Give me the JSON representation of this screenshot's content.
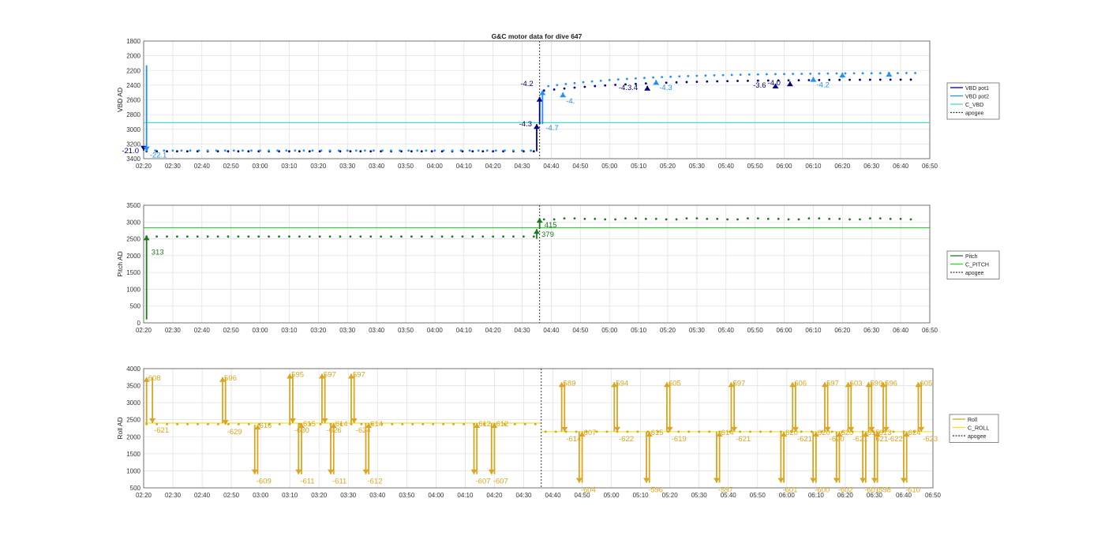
{
  "figure": {
    "title": "G&C motor data for dive 647"
  },
  "colors": {
    "vbd_pot1": "#00008B",
    "vbd_pot2": "#1E90FF",
    "c_vbd": "#40E0D0",
    "pitch": "#1E7A1E",
    "c_pitch": "#32CD32",
    "roll": "#DAA520",
    "c_roll": "#F0E130",
    "apogee": "#333333",
    "grid": "#e2e2e2"
  },
  "chart_data": [
    {
      "type": "scatter",
      "name": "vbd",
      "ylabel": "VBD AD",
      "xlabel": "",
      "xlim": [
        "02:20",
        "06:50"
      ],
      "xticks": [
        "02:20",
        "02:30",
        "02:40",
        "02:50",
        "03:00",
        "03:10",
        "03:20",
        "03:30",
        "03:40",
        "03:50",
        "04:00",
        "04:10",
        "04:20",
        "04:30",
        "04:40",
        "04:50",
        "05:00",
        "05:10",
        "05:20",
        "05:30",
        "05:40",
        "05:50",
        "06:00",
        "06:10",
        "06:20",
        "06:30",
        "06:40",
        "06:50"
      ],
      "ylim": [
        1800,
        3400
      ],
      "yreversed": true,
      "yticks": [
        1800,
        2000,
        2200,
        2400,
        2600,
        2800,
        3000,
        3200,
        3400
      ],
      "grid": true,
      "legend": [
        "VBD pot1",
        "VBD pot2",
        "C_VBD",
        "apogee"
      ],
      "apogee": "04:36",
      "c_line": 2910,
      "series": [
        {
          "name": "VBD pot1",
          "color_key": "vbd_pot1",
          "x_start": "02:21",
          "x_end": "06:45",
          "y_desc": 3300,
          "y_asc": 2320,
          "split": "04:36"
        },
        {
          "name": "VBD pot2",
          "color_key": "vbd_pot2",
          "x_start": "02:21",
          "x_end": "06:45",
          "y_desc": 3290,
          "y_asc": 2230,
          "split": "04:36"
        }
      ],
      "moves": [
        {
          "x": "02:20",
          "y_from": 3280,
          "y_to": 3290,
          "label": "-21.0",
          "series": "VBD pot1"
        },
        {
          "x": "02:21",
          "y_from": 2130,
          "y_to": 3300,
          "label": "-22.1",
          "series": "VBD pot2"
        },
        {
          "x": "04:35",
          "y_from": 3300,
          "y_to": 2930,
          "label": "-4.3",
          "series": "VBD pot1"
        },
        {
          "x": "04:36",
          "y_from": 2930,
          "y_to": 2560,
          "label": "-4.2",
          "series": "VBD pot1"
        },
        {
          "x": "04:37",
          "y_from": 2930,
          "y_to": 2470,
          "label": "-4.7",
          "series": "VBD pot2"
        },
        {
          "x": "04:44",
          "y_from": 2560,
          "y_to": 2500,
          "label": "-4.",
          "series": "VBD pot2"
        },
        {
          "x": "05:13",
          "y_from": 2470,
          "y_to": 2410,
          "label": "-4.3.4",
          "series": "VBD pot1"
        },
        {
          "x": "05:16",
          "y_from": 2380,
          "y_to": 2330,
          "label": "-4.3",
          "series": "VBD pot2"
        },
        {
          "x": "05:57",
          "y_from": 2400,
          "y_to": 2380,
          "label": "-3.6",
          "series": "VBD pot1"
        },
        {
          "x": "06:02",
          "y_from": 2380,
          "y_to": 2350,
          "label": "-4.0",
          "series": "VBD pot1"
        },
        {
          "x": "06:10",
          "y_from": 2340,
          "y_to": 2290,
          "label": "-4.2",
          "series": "VBD pot2"
        },
        {
          "x": "06:20",
          "y_from": 2300,
          "y_to": 2230,
          "label": "",
          "series": "VBD pot2"
        },
        {
          "x": "06:36",
          "y_from": 2280,
          "y_to": 2220,
          "label": "",
          "series": "VBD pot2"
        }
      ]
    },
    {
      "type": "scatter",
      "name": "pitch",
      "ylabel": "Pitch AD",
      "xlabel": "",
      "xlim": [
        "02:20",
        "06:50"
      ],
      "xticks": [
        "02:20",
        "02:30",
        "02:40",
        "02:50",
        "03:00",
        "03:10",
        "03:20",
        "03:30",
        "03:40",
        "03:50",
        "04:00",
        "04:10",
        "04:20",
        "04:30",
        "04:40",
        "04:50",
        "05:00",
        "05:10",
        "05:20",
        "05:30",
        "05:40",
        "05:50",
        "06:00",
        "06:10",
        "06:20",
        "06:30",
        "06:40",
        "06:50"
      ],
      "ylim": [
        0,
        3500
      ],
      "yticks": [
        0,
        500,
        1000,
        1500,
        2000,
        2500,
        3000,
        3500
      ],
      "grid": true,
      "legend": [
        "Pitch",
        "C_PITCH",
        "apogee"
      ],
      "apogee": "04:36",
      "c_line": 2830,
      "series": [
        {
          "name": "Pitch",
          "color_key": "pitch",
          "x_start": "02:21",
          "x_end": "06:45",
          "y_desc": 2570,
          "y_asc": 3110,
          "split": "04:36"
        }
      ],
      "moves": [
        {
          "x": "02:21",
          "y_from": 100,
          "y_to": 2600,
          "label": "313"
        },
        {
          "x": "04:35",
          "y_from": 2500,
          "y_to": 2790,
          "label": "379"
        },
        {
          "x": "04:36",
          "y_from": 2800,
          "y_to": 3120,
          "label": "415"
        }
      ]
    },
    {
      "type": "scatter",
      "name": "roll",
      "ylabel": "Roll AD",
      "xlabel": "",
      "xlim": [
        "02:20",
        "06:50"
      ],
      "xticks": [
        "02:20",
        "02:30",
        "02:40",
        "02:50",
        "03:00",
        "03:10",
        "03:20",
        "03:30",
        "03:40",
        "03:50",
        "04:00",
        "04:10",
        "04:20",
        "04:30",
        "04:40",
        "04:50",
        "05:00",
        "05:10",
        "05:20",
        "05:30",
        "05:40",
        "05:50",
        "06:00",
        "06:10",
        "06:20",
        "06:30",
        "06:40",
        "06:50"
      ],
      "ylim": [
        500,
        4000
      ],
      "yticks": [
        500,
        1000,
        1500,
        2000,
        2500,
        3000,
        3500,
        4000
      ],
      "grid": true,
      "legend": [
        "Roll",
        "C_ROLL",
        "apogee"
      ],
      "apogee": "04:36",
      "c_line_desc": 2400,
      "c_line_asc": 2150,
      "series": [
        {
          "name": "Roll",
          "color_key": "roll",
          "x_start": "02:21",
          "x_end": "06:45",
          "y_desc": 2370,
          "y_asc": 2150,
          "split": "04:36"
        }
      ],
      "moves": [
        {
          "x": "02:21",
          "y_from": 2400,
          "y_to": 3750,
          "label": "608"
        },
        {
          "x": "02:23",
          "y_from": 3750,
          "y_to": 2400,
          "label": "-621"
        },
        {
          "x": "02:47",
          "y_from": 2400,
          "y_to": 3750,
          "label": "596"
        },
        {
          "x": "02:48",
          "y_from": 3750,
          "y_to": 2350,
          "label": "-629"
        },
        {
          "x": "02:58",
          "y_from": 2350,
          "y_to": 900,
          "label": "-609"
        },
        {
          "x": "02:59",
          "y_from": 900,
          "y_to": 2350,
          "label": "616"
        },
        {
          "x": "03:10",
          "y_from": 2400,
          "y_to": 3850,
          "label": "595"
        },
        {
          "x": "03:11",
          "y_from": 3850,
          "y_to": 2400,
          "label": "-630"
        },
        {
          "x": "03:13",
          "y_from": 2400,
          "y_to": 900,
          "label": "-611"
        },
        {
          "x": "03:14",
          "y_from": 900,
          "y_to": 2400,
          "label": "615"
        },
        {
          "x": "03:21",
          "y_from": 2400,
          "y_to": 3850,
          "label": "597"
        },
        {
          "x": "03:22",
          "y_from": 3850,
          "y_to": 2400,
          "label": "-626"
        },
        {
          "x": "03:24",
          "y_from": 2400,
          "y_to": 900,
          "label": "-611"
        },
        {
          "x": "03:25",
          "y_from": 900,
          "y_to": 2400,
          "label": "614"
        },
        {
          "x": "03:31",
          "y_from": 2400,
          "y_to": 3850,
          "label": "597"
        },
        {
          "x": "03:32",
          "y_from": 3850,
          "y_to": 2400,
          "label": "-624"
        },
        {
          "x": "03:36",
          "y_from": 2400,
          "y_to": 900,
          "label": "-612"
        },
        {
          "x": "03:37",
          "y_from": 900,
          "y_to": 2400,
          "label": "614"
        },
        {
          "x": "04:13",
          "y_from": 2400,
          "y_to": 900,
          "label": "-607"
        },
        {
          "x": "04:14",
          "y_from": 900,
          "y_to": 2400,
          "label": "612"
        },
        {
          "x": "04:19",
          "y_from": 2400,
          "y_to": 900,
          "label": "-607"
        },
        {
          "x": "04:20",
          "y_from": 900,
          "y_to": 2400,
          "label": "612"
        },
        {
          "x": "04:43",
          "y_from": 2150,
          "y_to": 3600,
          "label": "589"
        },
        {
          "x": "04:44",
          "y_from": 3600,
          "y_to": 2150,
          "label": "-614"
        },
        {
          "x": "04:49",
          "y_from": 2150,
          "y_to": 650,
          "label": "-604"
        },
        {
          "x": "04:50",
          "y_from": 650,
          "y_to": 2150,
          "label": "607"
        },
        {
          "x": "05:01",
          "y_from": 2150,
          "y_to": 3600,
          "label": "594"
        },
        {
          "x": "05:02",
          "y_from": 3600,
          "y_to": 2150,
          "label": "-622"
        },
        {
          "x": "05:12",
          "y_from": 2150,
          "y_to": 650,
          "label": "-596"
        },
        {
          "x": "05:13",
          "y_from": 650,
          "y_to": 2150,
          "label": "615"
        },
        {
          "x": "05:19",
          "y_from": 2150,
          "y_to": 3600,
          "label": "605"
        },
        {
          "x": "05:20",
          "y_from": 3600,
          "y_to": 2150,
          "label": "-619"
        },
        {
          "x": "05:36",
          "y_from": 2150,
          "y_to": 650,
          "label": "-597"
        },
        {
          "x": "05:37",
          "y_from": 650,
          "y_to": 2150,
          "label": "614"
        },
        {
          "x": "05:41",
          "y_from": 2150,
          "y_to": 3600,
          "label": "597"
        },
        {
          "x": "05:42",
          "y_from": 3600,
          "y_to": 2150,
          "label": "-621"
        },
        {
          "x": "05:58",
          "y_from": 2150,
          "y_to": 650,
          "label": "-601"
        },
        {
          "x": "05:59",
          "y_from": 650,
          "y_to": 2150,
          "label": "620"
        },
        {
          "x": "06:02",
          "y_from": 2150,
          "y_to": 3600,
          "label": "606"
        },
        {
          "x": "06:03",
          "y_from": 3600,
          "y_to": 2150,
          "label": "-621"
        },
        {
          "x": "06:09",
          "y_from": 2150,
          "y_to": 650,
          "label": "-600"
        },
        {
          "x": "06:10",
          "y_from": 650,
          "y_to": 2150,
          "label": "620"
        },
        {
          "x": "06:13",
          "y_from": 2150,
          "y_to": 3600,
          "label": "597"
        },
        {
          "x": "06:14",
          "y_from": 3600,
          "y_to": 2150,
          "label": "-620"
        },
        {
          "x": "06:17",
          "y_from": 2150,
          "y_to": 650,
          "label": "-602"
        },
        {
          "x": "06:18",
          "y_from": 650,
          "y_to": 2150,
          "label": "620"
        },
        {
          "x": "06:21",
          "y_from": 2150,
          "y_to": 3600,
          "label": "603"
        },
        {
          "x": "06:22",
          "y_from": 3600,
          "y_to": 2150,
          "label": "-621"
        },
        {
          "x": "06:26",
          "y_from": 2150,
          "y_to": 650,
          "label": "-601"
        },
        {
          "x": "06:27",
          "y_from": 650,
          "y_to": 2150,
          "label": "615"
        },
        {
          "x": "06:28",
          "y_from": 2150,
          "y_to": 3600,
          "label": "599"
        },
        {
          "x": "06:29",
          "y_from": 3600,
          "y_to": 2150,
          "label": "-621"
        },
        {
          "x": "06:30",
          "y_from": 2150,
          "y_to": 650,
          "label": "-598"
        },
        {
          "x": "06:31",
          "y_from": 650,
          "y_to": 2150,
          "label": "613"
        },
        {
          "x": "06:33",
          "y_from": 2150,
          "y_to": 3600,
          "label": "596"
        },
        {
          "x": "06:34",
          "y_from": 3600,
          "y_to": 2150,
          "label": "-622"
        },
        {
          "x": "06:40",
          "y_from": 2150,
          "y_to": 650,
          "label": "-610"
        },
        {
          "x": "06:41",
          "y_from": 650,
          "y_to": 2150,
          "label": "624"
        },
        {
          "x": "06:45",
          "y_from": 2150,
          "y_to": 3600,
          "label": "605"
        },
        {
          "x": "06:46",
          "y_from": 3600,
          "y_to": 2150,
          "label": "-623"
        }
      ]
    }
  ]
}
